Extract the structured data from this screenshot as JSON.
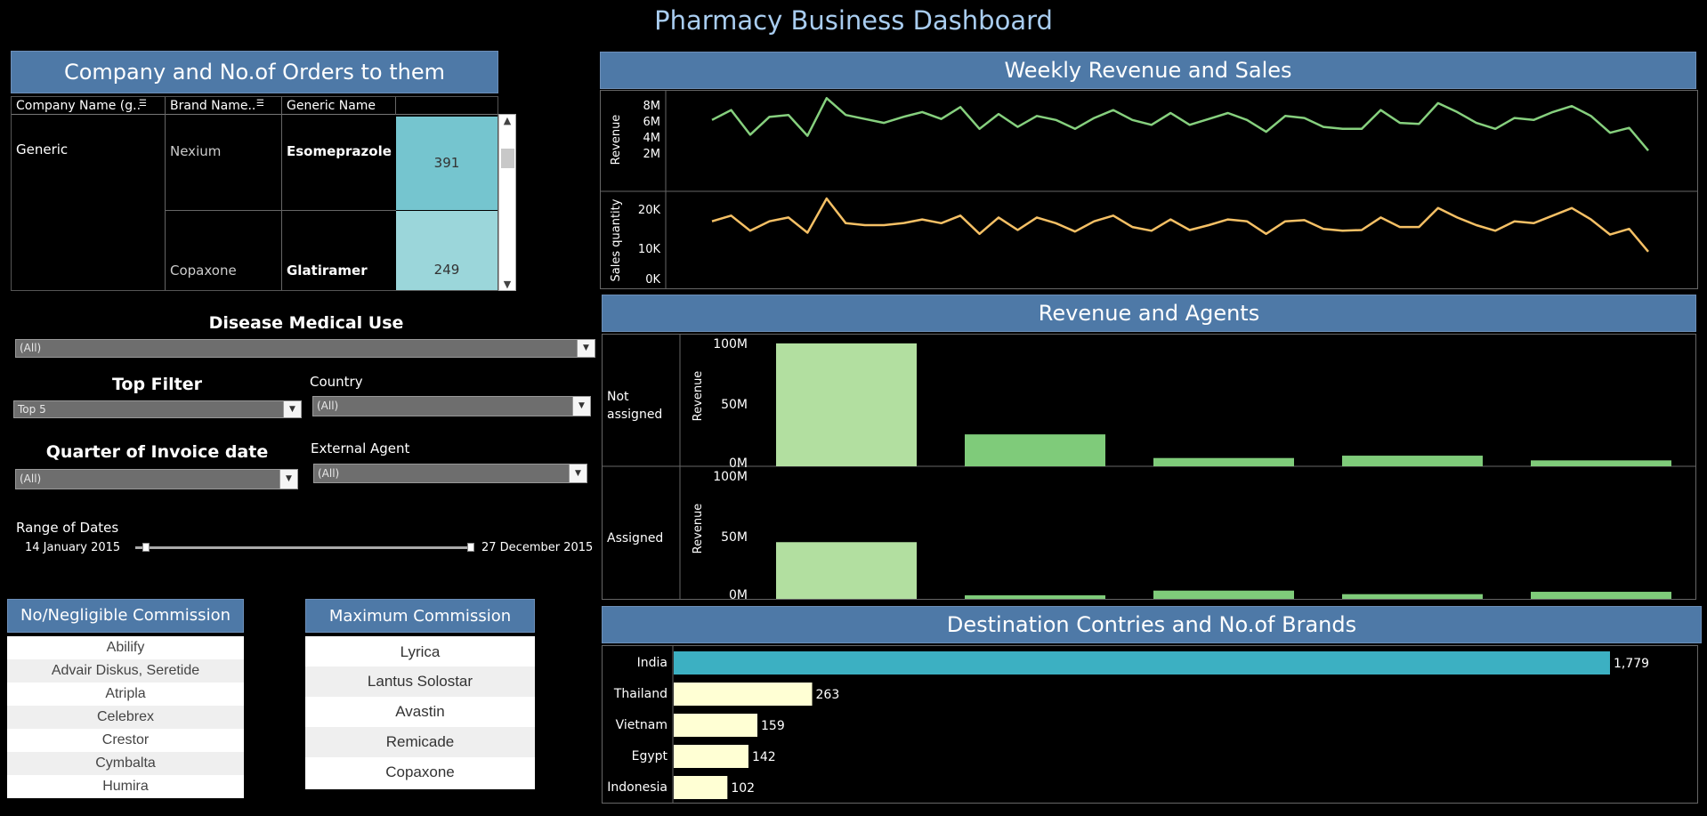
{
  "title": "Pharmacy Business Dashboard",
  "company_panel": {
    "header": "Company and No.of Orders to them",
    "columns": [
      "Company Name (g..",
      "Brand Name..",
      "Generic Name"
    ],
    "company": "Generic",
    "rows": [
      {
        "brand": "Nexium",
        "generic": "Esomeprazole",
        "orders": "391"
      },
      {
        "brand": "Copaxone",
        "generic": "Glatiramer",
        "orders": "249"
      }
    ]
  },
  "filters": {
    "disease": {
      "label": "Disease Medical Use",
      "value": "(All)"
    },
    "top": {
      "label": "Top Filter",
      "value": "Top 5"
    },
    "country": {
      "label": "Country",
      "value": "(All)"
    },
    "quarter": {
      "label": "Quarter of Invoice date",
      "value": "(All)"
    },
    "agent": {
      "label": "External Agent",
      "value": "(All)"
    },
    "range": {
      "label": "Range of Dates",
      "start": "14 January 2015",
      "end": "27 December 2015"
    }
  },
  "no_commission": {
    "header": "No/Negligible Commission",
    "items": [
      "Abilify",
      "Advair Diskus, Seretide",
      "Atripla",
      "Celebrex",
      "Crestor",
      "Cymbalta",
      "Humira"
    ]
  },
  "max_commission": {
    "header": "Maximum Commission",
    "items": [
      "Lyrica",
      "Lantus Solostar",
      "Avastin",
      "Remicade",
      "Copaxone"
    ]
  },
  "colors": {
    "header_bg": "#4e79a7",
    "revenue_line": "#86d07e",
    "sales_line": "#f5c065",
    "bar_light": "#b2dfa0",
    "bar_green": "#7fcb7a",
    "india_bar": "#3cb0c2",
    "country_bar": "#ffffd4",
    "order_box_1": "#75c5cf",
    "order_box_2": "#9bd6da"
  },
  "chart_data": [
    {
      "type": "line",
      "title": "Weekly Revenue and Sales",
      "series": [
        {
          "name": "Revenue",
          "ylabel": "Revenue",
          "yticks": [
            "8M",
            "6M",
            "4M",
            "2M"
          ],
          "ylim": [
            0,
            9
          ],
          "values": [
            6.5,
            7.5,
            5.0,
            6.8,
            7.0,
            4.9,
            8.7,
            7.0,
            6.6,
            6.2,
            6.8,
            7.3,
            6.6,
            7.8,
            5.6,
            7.1,
            5.8,
            6.9,
            6.5,
            5.6,
            6.7,
            7.5,
            6.5,
            6.0,
            7.2,
            6.0,
            6.6,
            7.2,
            6.5,
            5.3,
            6.9,
            6.7,
            5.8,
            5.6,
            5.6,
            7.5,
            6.2,
            6.1,
            8.2,
            7.3,
            6.2,
            5.6,
            6.7,
            6.5,
            7.3,
            7.9,
            6.9,
            5.2,
            5.7,
            3.4
          ]
        },
        {
          "name": "Sales quantity",
          "ylabel": "Sales quantity",
          "yticks": [
            "20K",
            "10K",
            "0K"
          ],
          "ylim": [
            0,
            23000
          ],
          "values": [
            16500,
            18000,
            14000,
            16500,
            17500,
            13500,
            22500,
            16000,
            15500,
            15500,
            16000,
            17000,
            16000,
            18000,
            13200,
            17500,
            14200,
            17500,
            16000,
            13800,
            16500,
            18000,
            15000,
            14000,
            17000,
            14200,
            15500,
            17000,
            16500,
            13200,
            16500,
            16800,
            14500,
            14000,
            14200,
            17500,
            15000,
            15000,
            20000,
            17500,
            15500,
            14000,
            16500,
            16000,
            18000,
            20000,
            17000,
            13000,
            14500,
            8500
          ]
        }
      ]
    },
    {
      "type": "bar",
      "title": "Revenue and Agents",
      "ylabel": "Revenue",
      "yticks": [
        "100M",
        "50M",
        "0M"
      ],
      "ylim": [
        0,
        112
      ],
      "panels": [
        {
          "name": "Not assigned",
          "values": [
            104,
            27,
            7,
            9,
            5
          ]
        },
        {
          "name": "Assigned",
          "values": [
            48,
            3,
            7,
            4,
            6
          ]
        }
      ]
    },
    {
      "type": "bar",
      "orientation": "horizontal",
      "title": "Destination Contries and No.of Brands",
      "categories": [
        "India",
        "Thailand",
        "Vietnam",
        "Egypt",
        "Indonesia"
      ],
      "values": [
        1779,
        263,
        159,
        142,
        102
      ],
      "labels": [
        "1,779",
        "263",
        "159",
        "142",
        "102"
      ]
    }
  ]
}
